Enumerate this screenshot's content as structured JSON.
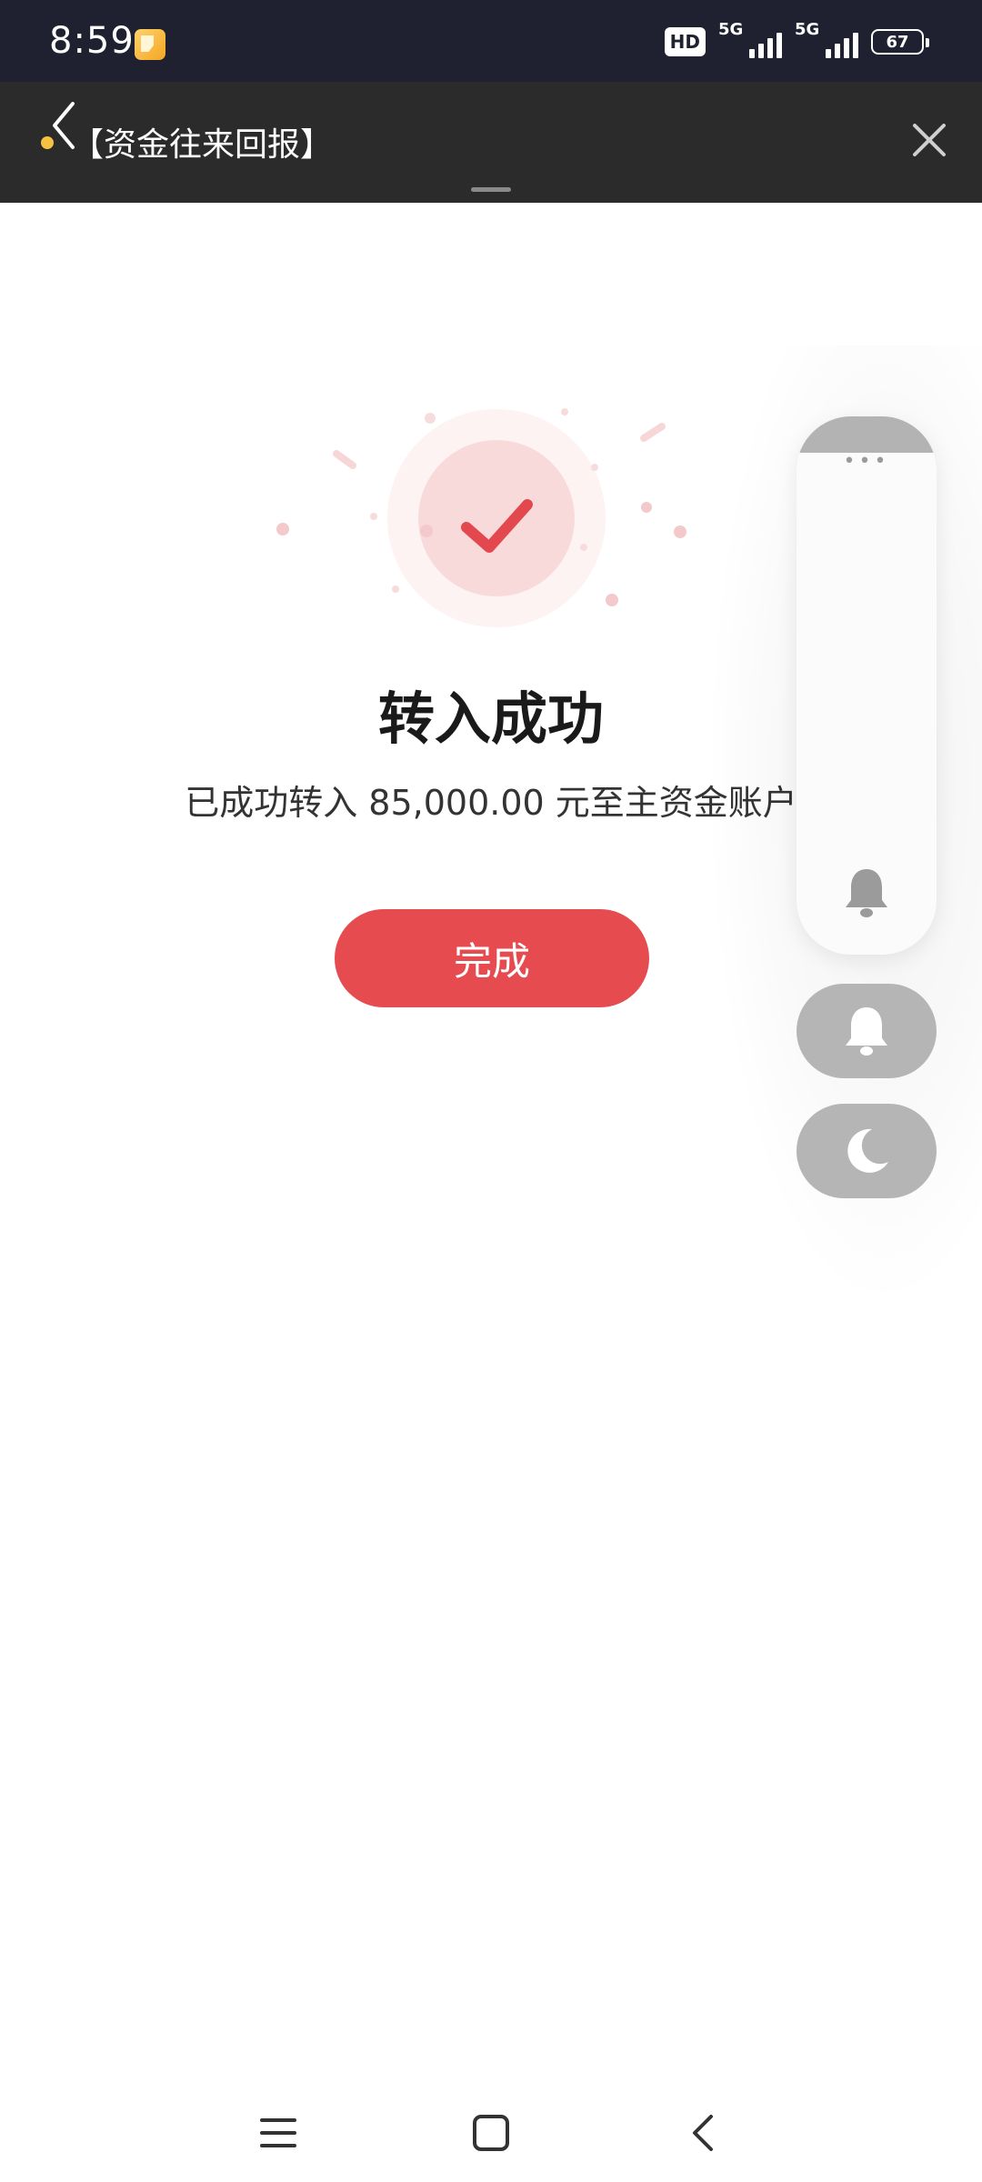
{
  "status_bar": {
    "time": "8:59",
    "hd_label": "HD",
    "network1": "5G",
    "network2": "5G",
    "battery": "67"
  },
  "header": {
    "title": "【资金往来回报】"
  },
  "success": {
    "title": "转入成功",
    "description": "已成功转入 85,000.00 元至主资金账户",
    "done_label": "完成"
  },
  "side_panel": {
    "menu_glyph": "•••"
  },
  "colors": {
    "status_bar_bg": "#1f2130",
    "header_bg": "#2b2b2b",
    "accent": "#e54b4f",
    "header_dot": "#f5c242"
  },
  "icons": {
    "app_icon": "notes-app-icon",
    "back": "chevron-left-icon",
    "close": "close-icon",
    "success": "checkmark-icon",
    "bell": "bell-icon",
    "moon": "moon-icon",
    "nav_menu": "menu-icon",
    "nav_home": "home-square-icon",
    "nav_back": "back-icon"
  }
}
